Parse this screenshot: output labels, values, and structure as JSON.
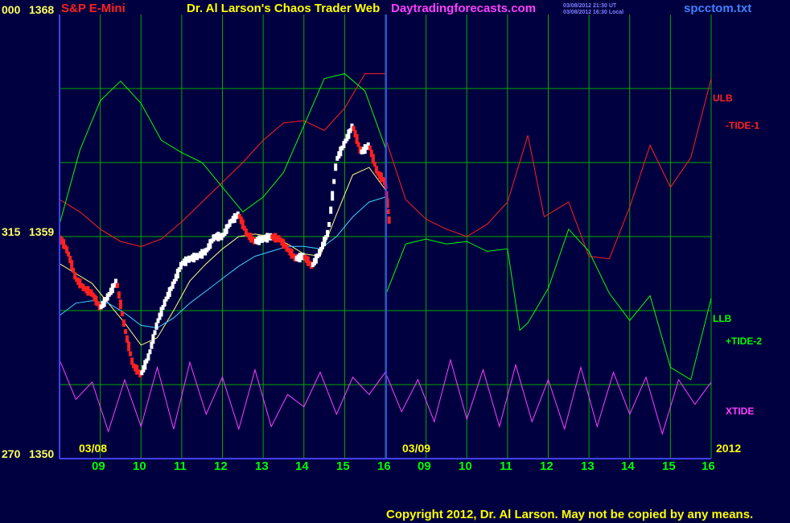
{
  "header": {
    "symbol": "S&P E-Mini",
    "title": "Dr. Al Larson's Chaos Trader Web",
    "site": "Daytradingforecasts.com",
    "stamp_ut": "03/08/2012 21:30 UT",
    "stamp_local": "03/08/2012 16:30 Local",
    "file": "spcctom.txt"
  },
  "y_labels": [
    {
      "left": "000",
      "right": "1368"
    },
    {
      "left": "315",
      "right": "1359"
    },
    {
      "left": "270",
      "right": "1350"
    }
  ],
  "x_labels": {
    "date_left": "03/08",
    "date_right": "03/09",
    "year": "2012",
    "ticks": [
      "09",
      "10",
      "11",
      "12",
      "13",
      "14",
      "15",
      "16",
      "09",
      "10",
      "11",
      "12",
      "13",
      "14",
      "15",
      "16"
    ]
  },
  "side_labels": {
    "ulb": "ULB",
    "tide1": "-TIDE-1",
    "llb": "LLB",
    "tide2": "+TIDE-2",
    "xtide": "XTIDE"
  },
  "copyright": "Copyright 2012, Dr. Al Larson. May not be copied by any means.",
  "colors": {
    "background": "#000040",
    "grid": "#00aa00",
    "frame": "#4040ff",
    "price_up": "#ffffff",
    "price_down": "#ff2020",
    "ulb_tide1": "#ff2020",
    "llb_tide2": "#00ff00",
    "xtide": "#ff40ff",
    "ma_fast": "#ffff80",
    "ma_slow": "#40d0ff"
  },
  "chart_data": {
    "type": "line",
    "title": "S&P E-Mini",
    "ylim": [
      1350,
      1368
    ],
    "y_ticks": [
      1350,
      1359,
      1368
    ],
    "x_ticks": [
      "09",
      "10",
      "11",
      "12",
      "13",
      "14",
      "15",
      "16",
      "09",
      "10",
      "11",
      "12",
      "13",
      "14",
      "15",
      "16"
    ],
    "x_range": [
      8.0,
      24.0
    ],
    "series": [
      {
        "name": "ULB",
        "points": [
          [
            8.0,
            1360.5
          ],
          [
            8.5,
            1360.0
          ],
          [
            9.0,
            1359.3
          ],
          [
            9.5,
            1358.8
          ],
          [
            10.0,
            1358.6
          ],
          [
            10.5,
            1358.9
          ],
          [
            11.0,
            1359.6
          ],
          [
            11.5,
            1360.4
          ],
          [
            12.0,
            1361.2
          ],
          [
            12.5,
            1362.0
          ],
          [
            13.0,
            1362.9
          ],
          [
            13.5,
            1363.6
          ],
          [
            14.0,
            1363.7
          ],
          [
            14.5,
            1363.3
          ],
          [
            15.0,
            1364.2
          ],
          [
            15.5,
            1365.6
          ],
          [
            16.0,
            1365.6
          ]
        ]
      },
      {
        "name": "LLB",
        "points": [
          [
            8.0,
            1359.5
          ],
          [
            8.5,
            1362.5
          ],
          [
            9.0,
            1364.5
          ],
          [
            9.5,
            1365.3
          ],
          [
            10.0,
            1364.4
          ],
          [
            10.5,
            1362.9
          ],
          [
            11.0,
            1362.4
          ],
          [
            11.5,
            1362.0
          ],
          [
            12.0,
            1361.0
          ],
          [
            12.5,
            1360.0
          ],
          [
            13.0,
            1360.6
          ],
          [
            13.5,
            1361.6
          ],
          [
            14.0,
            1363.5
          ],
          [
            14.5,
            1365.4
          ],
          [
            15.0,
            1365.6
          ],
          [
            15.5,
            1364.9
          ],
          [
            16.0,
            1362.6
          ]
        ]
      },
      {
        "name": "-TIDE-1",
        "points": [
          [
            16.0,
            1363.0
          ],
          [
            16.5,
            1360.5
          ],
          [
            17.0,
            1359.7
          ],
          [
            17.5,
            1359.3
          ],
          [
            18.0,
            1359.0
          ],
          [
            18.5,
            1359.5
          ],
          [
            19.0,
            1360.4
          ],
          [
            19.5,
            1363.1
          ],
          [
            19.9,
            1359.8
          ],
          [
            20.5,
            1360.4
          ],
          [
            21.0,
            1358.2
          ],
          [
            21.5,
            1358.1
          ],
          [
            22.0,
            1360.2
          ],
          [
            22.5,
            1362.7
          ],
          [
            23.0,
            1361.0
          ],
          [
            23.5,
            1362.2
          ],
          [
            24.0,
            1365.4
          ]
        ]
      },
      {
        "name": "+TIDE-2",
        "points": [
          [
            16.0,
            1356.6
          ],
          [
            16.5,
            1358.7
          ],
          [
            17.0,
            1358.9
          ],
          [
            17.5,
            1358.7
          ],
          [
            18.0,
            1358.8
          ],
          [
            18.5,
            1358.4
          ],
          [
            19.0,
            1358.5
          ],
          [
            19.3,
            1355.2
          ],
          [
            19.5,
            1355.5
          ],
          [
            20.0,
            1356.9
          ],
          [
            20.5,
            1359.3
          ],
          [
            21.0,
            1358.4
          ],
          [
            21.5,
            1356.7
          ],
          [
            22.0,
            1355.6
          ],
          [
            22.5,
            1356.6
          ],
          [
            23.0,
            1353.7
          ],
          [
            23.5,
            1353.2
          ],
          [
            24.0,
            1356.5
          ]
        ]
      },
      {
        "name": "XTIDE",
        "points": [
          [
            8.0,
            1354.0
          ],
          [
            8.4,
            1352.4
          ],
          [
            8.8,
            1353.1
          ],
          [
            9.2,
            1351.1
          ],
          [
            9.6,
            1353.2
          ],
          [
            10.0,
            1351.3
          ],
          [
            10.4,
            1353.7
          ],
          [
            10.8,
            1351.2
          ],
          [
            11.2,
            1353.9
          ],
          [
            11.6,
            1351.8
          ],
          [
            12.0,
            1353.3
          ],
          [
            12.4,
            1351.2
          ],
          [
            12.8,
            1353.6
          ],
          [
            13.2,
            1351.3
          ],
          [
            13.6,
            1352.6
          ],
          [
            14.0,
            1352.1
          ],
          [
            14.4,
            1353.5
          ],
          [
            14.8,
            1351.8
          ],
          [
            15.2,
            1353.3
          ],
          [
            15.6,
            1352.6
          ],
          [
            16.0,
            1353.5
          ],
          [
            16.4,
            1351.9
          ],
          [
            16.8,
            1353.2
          ],
          [
            17.2,
            1351.5
          ],
          [
            17.6,
            1354.0
          ],
          [
            18.0,
            1351.6
          ],
          [
            18.4,
            1353.6
          ],
          [
            18.8,
            1351.3
          ],
          [
            19.2,
            1353.8
          ],
          [
            19.6,
            1351.5
          ],
          [
            20.0,
            1353.2
          ],
          [
            20.4,
            1351.2
          ],
          [
            20.8,
            1353.7
          ],
          [
            21.2,
            1351.3
          ],
          [
            21.6,
            1353.5
          ],
          [
            22.0,
            1351.8
          ],
          [
            22.4,
            1353.3
          ],
          [
            22.8,
            1351.0
          ],
          [
            23.2,
            1353.2
          ],
          [
            23.6,
            1352.2
          ],
          [
            24.0,
            1353.1
          ]
        ]
      },
      {
        "name": "Price",
        "points": [
          [
            8.0,
            1359.0
          ],
          [
            8.2,
            1358.4
          ],
          [
            8.4,
            1357.3
          ],
          [
            8.6,
            1356.9
          ],
          [
            8.8,
            1356.7
          ],
          [
            9.0,
            1356.1
          ],
          [
            9.2,
            1356.6
          ],
          [
            9.4,
            1357.2
          ],
          [
            9.6,
            1355.3
          ],
          [
            9.8,
            1353.8
          ],
          [
            10.0,
            1353.4
          ],
          [
            10.2,
            1354.2
          ],
          [
            10.4,
            1355.5
          ],
          [
            10.6,
            1356.4
          ],
          [
            10.8,
            1357.1
          ],
          [
            11.0,
            1357.9
          ],
          [
            11.2,
            1358.1
          ],
          [
            11.4,
            1358.2
          ],
          [
            11.6,
            1358.4
          ],
          [
            11.8,
            1359.0
          ],
          [
            12.0,
            1359.0
          ],
          [
            12.2,
            1359.6
          ],
          [
            12.4,
            1359.9
          ],
          [
            12.6,
            1359.1
          ],
          [
            12.8,
            1358.8
          ],
          [
            13.0,
            1358.9
          ],
          [
            13.2,
            1359.0
          ],
          [
            13.4,
            1358.9
          ],
          [
            13.6,
            1358.5
          ],
          [
            13.8,
            1358.1
          ],
          [
            14.0,
            1358.2
          ],
          [
            14.2,
            1357.8
          ],
          [
            14.4,
            1358.4
          ],
          [
            14.6,
            1359.2
          ],
          [
            14.8,
            1362.1
          ],
          [
            15.0,
            1362.8
          ],
          [
            15.2,
            1363.5
          ],
          [
            15.4,
            1362.4
          ],
          [
            15.6,
            1362.7
          ],
          [
            15.8,
            1361.6
          ],
          [
            16.0,
            1361.2
          ],
          [
            16.1,
            1359.5
          ]
        ]
      },
      {
        "name": "MA fast",
        "points": [
          [
            8.0,
            1357.9
          ],
          [
            8.4,
            1357.5
          ],
          [
            8.8,
            1357.1
          ],
          [
            9.2,
            1356.3
          ],
          [
            9.6,
            1355.5
          ],
          [
            10.0,
            1354.6
          ],
          [
            10.4,
            1354.9
          ],
          [
            10.8,
            1356.0
          ],
          [
            11.2,
            1357.2
          ],
          [
            11.6,
            1357.9
          ],
          [
            12.0,
            1358.5
          ],
          [
            12.4,
            1359.0
          ],
          [
            12.8,
            1359.1
          ],
          [
            13.2,
            1359.0
          ],
          [
            13.6,
            1358.7
          ],
          [
            14.0,
            1358.3
          ],
          [
            14.4,
            1358.2
          ],
          [
            14.8,
            1359.9
          ],
          [
            15.2,
            1361.5
          ],
          [
            15.6,
            1361.8
          ],
          [
            16.0,
            1360.9
          ]
        ]
      },
      {
        "name": "MA slow",
        "points": [
          [
            8.0,
            1355.8
          ],
          [
            8.4,
            1356.3
          ],
          [
            8.8,
            1356.4
          ],
          [
            9.2,
            1356.3
          ],
          [
            9.6,
            1355.9
          ],
          [
            10.0,
            1355.4
          ],
          [
            10.4,
            1355.3
          ],
          [
            10.8,
            1355.7
          ],
          [
            11.2,
            1356.3
          ],
          [
            11.6,
            1356.8
          ],
          [
            12.0,
            1357.3
          ],
          [
            12.4,
            1357.8
          ],
          [
            12.8,
            1358.2
          ],
          [
            13.2,
            1358.4
          ],
          [
            13.6,
            1358.6
          ],
          [
            14.0,
            1358.6
          ],
          [
            14.4,
            1358.5
          ],
          [
            14.8,
            1359.0
          ],
          [
            15.2,
            1359.8
          ],
          [
            15.6,
            1360.4
          ],
          [
            16.0,
            1360.6
          ]
        ]
      }
    ]
  }
}
